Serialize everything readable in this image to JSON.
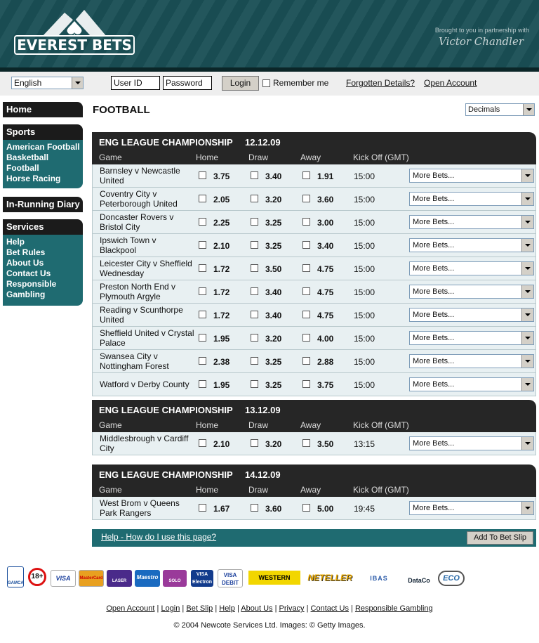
{
  "header": {
    "logo_text": "EVEREST BETS",
    "partner_line": "Brought to you in partnership with",
    "partner_name": "Victor Chandler"
  },
  "login": {
    "language": "English",
    "userid_placeholder": "User ID",
    "password_placeholder": "Password",
    "login_label": "Login",
    "remember_label": "Remember me",
    "forgotten_label": "Forgotten Details?",
    "open_account_label": "Open Account"
  },
  "sidebar": {
    "home": "Home",
    "sports_title": "Sports",
    "sports": [
      "American Football",
      "Basketball",
      "Football",
      "Horse Racing"
    ],
    "inrunning": "In-Running Diary",
    "services_title": "Services",
    "services": [
      "Help",
      "Bet Rules",
      "About Us",
      "Contact Us",
      "Responsible",
      "Gambling"
    ]
  },
  "main": {
    "title": "FOOTBALL",
    "odds_format": "Decimals",
    "columns": {
      "game": "Game",
      "home": "Home",
      "draw": "Draw",
      "away": "Away",
      "kickoff": "Kick Off (GMT)"
    },
    "more_bets": "More Bets...",
    "blocks": [
      {
        "title": "ENG LEAGUE CHAMPIONSHIP",
        "date": "12.12.09",
        "rows": [
          {
            "l1": "Barnsley v Newcastle",
            "l2": "United",
            "home": "3.75",
            "draw": "3.40",
            "away": "1.91",
            "ko": "15:00"
          },
          {
            "l1": "Coventry City v",
            "l2": "Peterborough United",
            "home": "2.05",
            "draw": "3.20",
            "away": "3.60",
            "ko": "15:00"
          },
          {
            "l1": "Doncaster Rovers v",
            "l2": "Bristol City",
            "home": "2.25",
            "draw": "3.25",
            "away": "3.00",
            "ko": "15:00"
          },
          {
            "l1": "Ipswich Town v",
            "l2": "Blackpool",
            "home": "2.10",
            "draw": "3.25",
            "away": "3.40",
            "ko": "15:00"
          },
          {
            "l1": "Leicester City v Sheffield",
            "l2": "Wednesday",
            "home": "1.72",
            "draw": "3.50",
            "away": "4.75",
            "ko": "15:00"
          },
          {
            "l1": "Preston North End v",
            "l2": "Plymouth Argyle",
            "home": "1.72",
            "draw": "3.40",
            "away": "4.75",
            "ko": "15:00"
          },
          {
            "l1": "Reading v Scunthorpe",
            "l2": "United",
            "home": "1.72",
            "draw": "3.40",
            "away": "4.75",
            "ko": "15:00"
          },
          {
            "l1": "Sheffield United v Crystal",
            "l2": "Palace",
            "home": "1.95",
            "draw": "3.20",
            "away": "4.00",
            "ko": "15:00"
          },
          {
            "l1": "Swansea City v",
            "l2": "Nottingham Forest",
            "home": "2.38",
            "draw": "3.25",
            "away": "2.88",
            "ko": "15:00"
          },
          {
            "l1": "Watford v Derby County",
            "l2": "",
            "home": "1.95",
            "draw": "3.25",
            "away": "3.75",
            "ko": "15:00"
          }
        ]
      },
      {
        "title": "ENG LEAGUE CHAMPIONSHIP",
        "date": "13.12.09",
        "rows": [
          {
            "l1": "Middlesbrough v Cardiff",
            "l2": "City",
            "home": "2.10",
            "draw": "3.20",
            "away": "3.50",
            "ko": "13:15"
          }
        ]
      },
      {
        "title": "ENG LEAGUE CHAMPIONSHIP",
        "date": "14.12.09",
        "rows": [
          {
            "l1": "West Brom v Queens",
            "l2": "Park Rangers",
            "home": "1.67",
            "draw": "3.60",
            "away": "5.00",
            "ko": "19:45"
          }
        ]
      }
    ],
    "help_link": "Help - How do I use this page?",
    "add_bet_slip": "Add To Bet Slip"
  },
  "payment_logos": [
    "GAMCARE",
    "18+",
    "VISA",
    "MasterCard",
    "LASER",
    "Maestro",
    "SOLO",
    "VISA Electron",
    "VISA DEBIT",
    "WESTERN UNION",
    "NETELLER",
    "IBAS",
    "DataCo",
    "ECO"
  ],
  "footer": {
    "links": [
      "Open Account",
      "Login",
      "Bet Slip",
      "Help",
      "About Us",
      "Privacy",
      "Contact Us",
      "Responsible Gambling"
    ],
    "copyright": "© 2004 Newcote Services Ltd. Images: © Getty Images."
  }
}
